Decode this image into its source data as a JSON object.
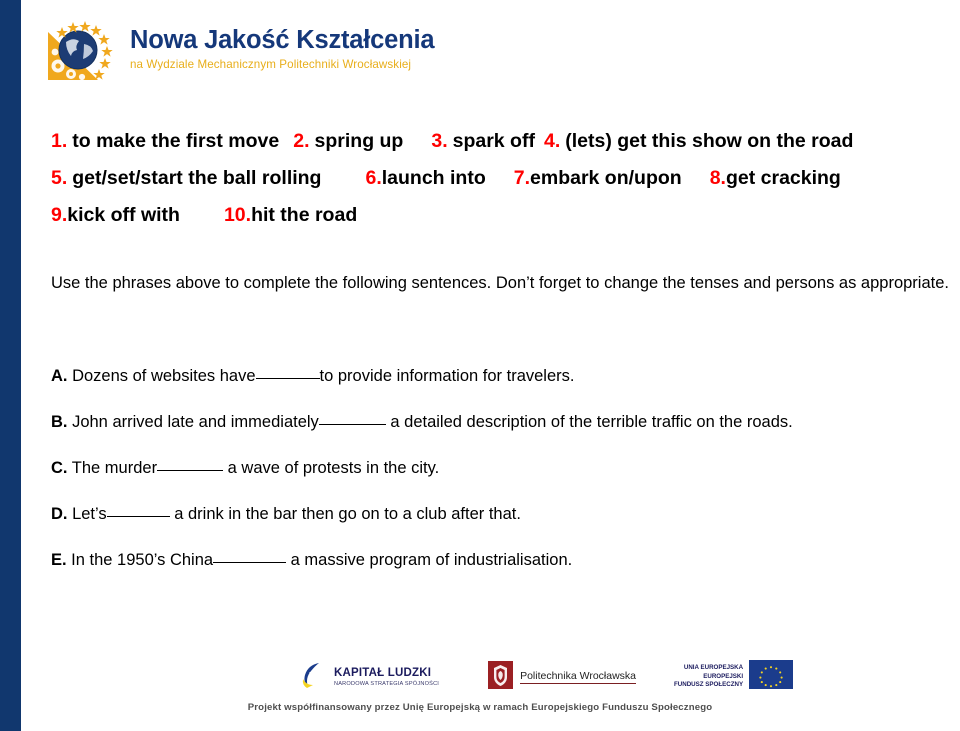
{
  "header": {
    "logo_name": "nowa-jakosc-ksztalcenia-logo",
    "title": "Nowa Jakość Kształcenia",
    "subtitle": "na Wydziale Mechanicznym Politechniki Wrocławskiej",
    "colors": {
      "title": "#15387a",
      "subtitle": "#e8ae1b",
      "stripe": "#11376e"
    }
  },
  "phrases": {
    "accent_color": "#ff0000",
    "items": [
      {
        "num": "1.",
        "text": "to make the first move"
      },
      {
        "num": "2.",
        "text": "spring up"
      },
      {
        "num": "3.",
        "text": "spark off"
      },
      {
        "num": "4.",
        "text": "(lets) get this show on the road"
      },
      {
        "num": "5.",
        "text": "get/set/start the ball rolling"
      },
      {
        "num": "6.",
        "text": "launch into"
      },
      {
        "num": "7.",
        "text": "embark on/upon"
      },
      {
        "num": "8.",
        "text": "get cracking"
      },
      {
        "num": "9.",
        "text": "kick off with"
      },
      {
        "num": "10.",
        "text": "hit the road"
      }
    ]
  },
  "instruction": {
    "text": "Use the phrases above to complete the following sentences. Don’t forget to change the tenses and persons as appropriate."
  },
  "sentences": [
    {
      "letter": "A.",
      "before": " Dozens of websites have",
      "after": "to provide information for travelers."
    },
    {
      "letter": "B.",
      "before": " John arrived late and immediately",
      "after": " a detailed description of the terrible traffic on the roads."
    },
    {
      "letter": "C.",
      "before": " The murder",
      "after": " a wave of protests in the city."
    },
    {
      "letter": "D.",
      "before": " Let’s",
      "after": " a drink in the bar then go on to a club after that."
    },
    {
      "letter": "E.",
      "before": " In the 1950’s China",
      "after": " a massive program of industrialisation."
    }
  ],
  "footer": {
    "kapital_ludzki": {
      "main": "KAPITAŁ LUDZKI",
      "sub": "NARODOWA STRATEGIA SPÓJNOŚCI"
    },
    "politechnika": {
      "name": "Politechnika Wrocławska"
    },
    "unia_europejska": {
      "line1": "UNIA EUROPEJSKA",
      "line2": "EUROPEJSKI",
      "line3": "FUNDUSZ SPOŁECZNY"
    },
    "caption": "Projekt współfinansowany przez Unię Europejską w ramach Europejskiego Funduszu Społecznego"
  }
}
